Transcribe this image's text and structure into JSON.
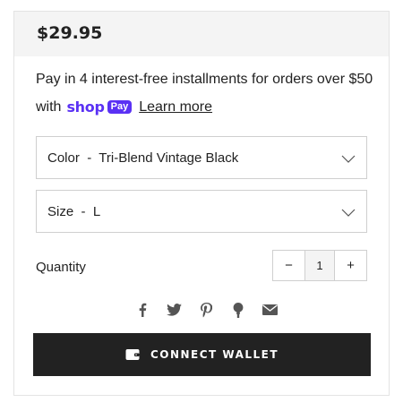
{
  "product": {
    "price": "$29.95"
  },
  "installments": {
    "line1": "Pay in 4 interest-free installments for orders over $50",
    "with_text": "with",
    "brand_shop": "shop",
    "brand_pay": "Pay",
    "learn_more": "Learn more",
    "brand_color": "#5a31f4"
  },
  "options": {
    "color": {
      "label": "Color",
      "separator": "-",
      "selected": "Tri-Blend Vintage Black"
    },
    "size": {
      "label": "Size",
      "separator": "-",
      "selected": "L"
    }
  },
  "quantity": {
    "label": "Quantity",
    "decrement": "−",
    "value": "1",
    "increment": "+"
  },
  "share_icons": [
    "facebook-icon",
    "twitter-icon",
    "pinterest-icon",
    "fancy-icon",
    "email-icon"
  ],
  "cta": {
    "label": "CONNECT WALLET",
    "icon": "wallet-icon",
    "background": "#222222"
  }
}
